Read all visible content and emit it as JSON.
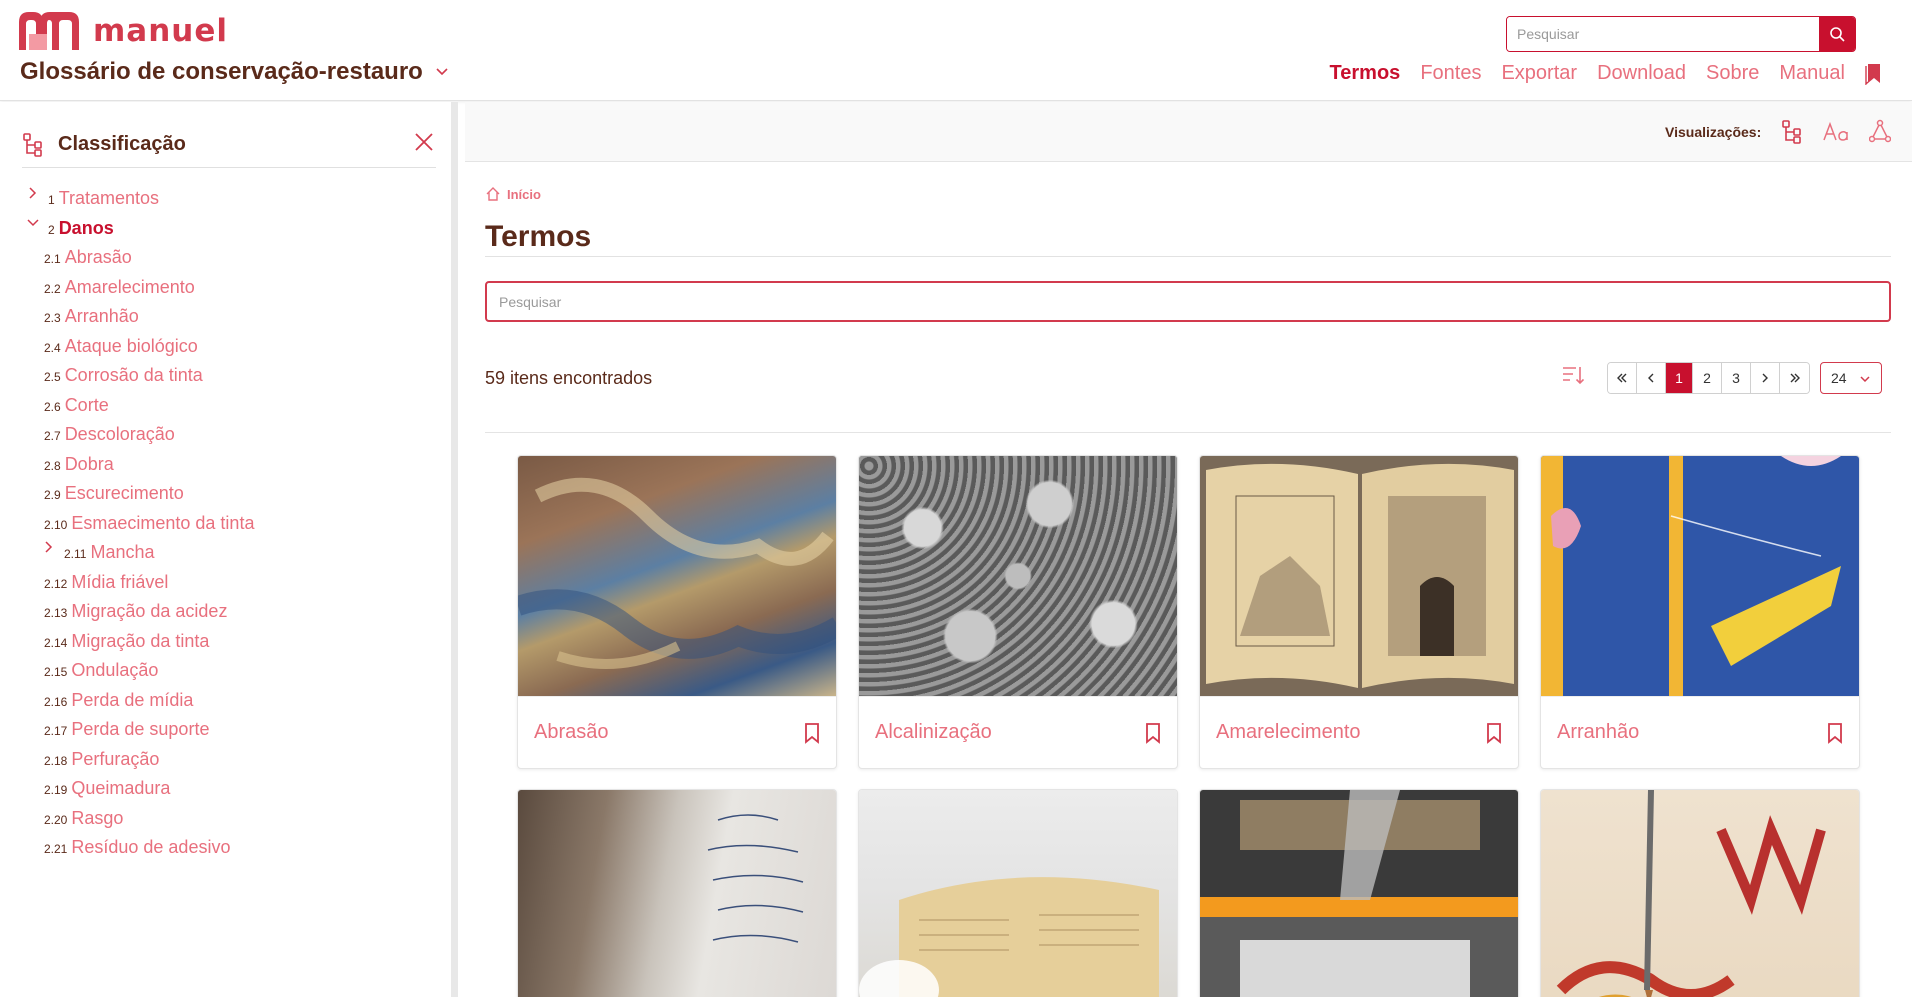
{
  "header": {
    "logo_text": "manuel",
    "app_title": "Glossário de conservação-restauro",
    "search_placeholder": "Pesquisar",
    "nav": [
      "Termos",
      "Fontes",
      "Exportar",
      "Download",
      "Sobre",
      "Manual"
    ],
    "active_nav": "Termos"
  },
  "sidebar": {
    "title": "Classificação",
    "items": [
      {
        "num": "1",
        "label": "Tratamentos",
        "toggle": "collapsed"
      },
      {
        "num": "2",
        "label": "Danos",
        "toggle": "expanded"
      },
      {
        "num": "2.1",
        "label": "Abrasão"
      },
      {
        "num": "2.2",
        "label": "Amarelecimento"
      },
      {
        "num": "2.3",
        "label": "Arranhão"
      },
      {
        "num": "2.4",
        "label": "Ataque biológico"
      },
      {
        "num": "2.5",
        "label": "Corrosão da tinta"
      },
      {
        "num": "2.6",
        "label": "Corte"
      },
      {
        "num": "2.7",
        "label": "Descoloração"
      },
      {
        "num": "2.8",
        "label": "Dobra"
      },
      {
        "num": "2.9",
        "label": "Escurecimento"
      },
      {
        "num": "2.10",
        "label": "Esmaecimento da tinta"
      },
      {
        "num": "2.11",
        "label": "Mancha",
        "toggle": "collapsed"
      },
      {
        "num": "2.12",
        "label": "Mídia friável"
      },
      {
        "num": "2.13",
        "label": "Migração da acidez"
      },
      {
        "num": "2.14",
        "label": "Migração da tinta"
      },
      {
        "num": "2.15",
        "label": "Ondulação"
      },
      {
        "num": "2.16",
        "label": "Perda de mídia"
      },
      {
        "num": "2.17",
        "label": "Perda de suporte"
      },
      {
        "num": "2.18",
        "label": "Perfuração"
      },
      {
        "num": "2.19",
        "label": "Queimadura"
      },
      {
        "num": "2.20",
        "label": "Rasgo"
      },
      {
        "num": "2.21",
        "label": "Resíduo de adesivo"
      }
    ]
  },
  "main": {
    "viz_label": "Visualizações:",
    "breadcrumb": "Início",
    "title": "Termos",
    "search_placeholder": "Pesquisar",
    "count_text": "59 itens encontrados",
    "pages": [
      "1",
      "2",
      "3"
    ],
    "current_page": "1",
    "per_page": "24",
    "cards": [
      {
        "label": "Abrasão",
        "image": "marbled-paper-abrasion"
      },
      {
        "label": "Alcalinização",
        "image": "micrograph-particles"
      },
      {
        "label": "Amarelecimento",
        "image": "yellowed-open-book"
      },
      {
        "label": "Arranhão",
        "image": "scratched-blue-print"
      },
      {
        "label": "",
        "image": "burnt-manuscript"
      },
      {
        "label": "",
        "image": "book-under-treatment"
      },
      {
        "label": "",
        "image": "print-on-frame"
      },
      {
        "label": "",
        "image": "illuminated-manuscript-brush"
      }
    ]
  },
  "colors": {
    "brand": "#c8102e",
    "link": "#e8707e",
    "text": "#5a2a1a"
  }
}
